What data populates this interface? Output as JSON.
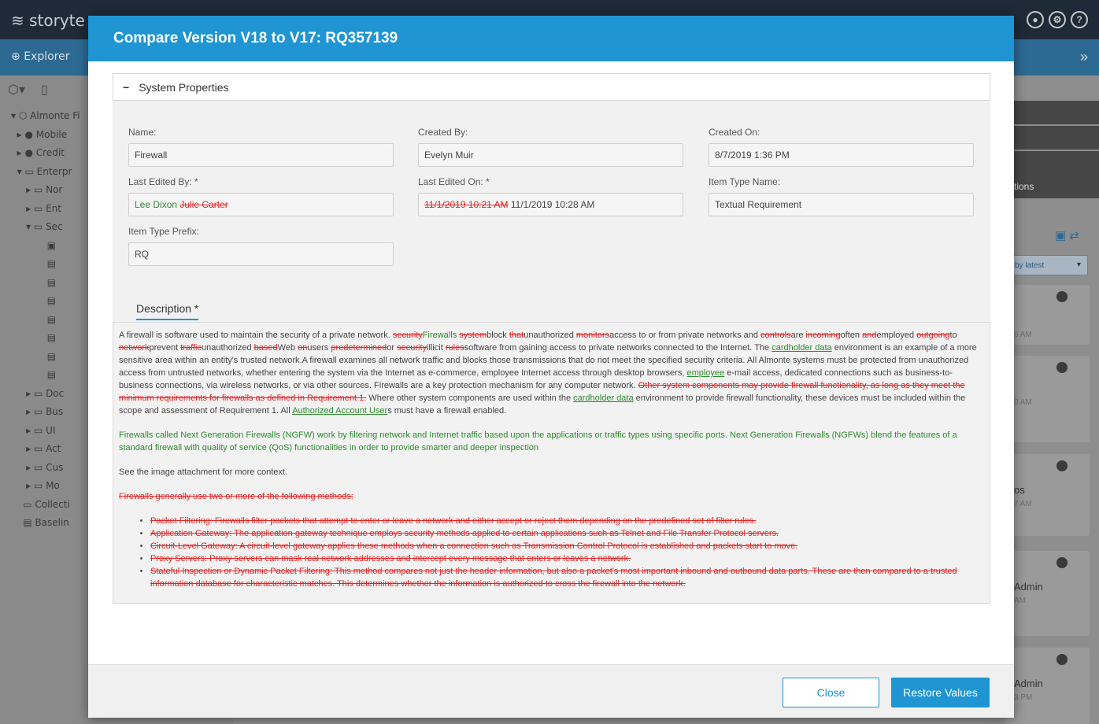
{
  "app": {
    "brand": "storyte",
    "explorer_label": "Explorer",
    "top_icons": [
      "user-icon",
      "settings-icon",
      "help-icon"
    ]
  },
  "tree": [
    {
      "label": "Almonte Fi"
    },
    {
      "label": "Mobile"
    },
    {
      "label": "Credit"
    },
    {
      "label": "Enterpr"
    },
    {
      "label": "Nor"
    },
    {
      "label": "Ent"
    },
    {
      "label": "Sec"
    },
    {
      "label": ""
    },
    {
      "label": ""
    },
    {
      "label": ""
    },
    {
      "label": ""
    },
    {
      "label": ""
    },
    {
      "label": ""
    },
    {
      "label": ""
    },
    {
      "label": ""
    },
    {
      "label": "Doc"
    },
    {
      "label": "Bus"
    },
    {
      "label": "UI"
    },
    {
      "label": "Act"
    },
    {
      "label": "Cus"
    },
    {
      "label": "Mo"
    },
    {
      "label": "Collecti"
    },
    {
      "label": "Baselin"
    }
  ],
  "right_panel": {
    "tab_text": "tions",
    "sort_label": "by latest",
    "cards": [
      {
        "title": "",
        "sub": "6 AM"
      },
      {
        "title": "",
        "sub": "0 AM"
      },
      {
        "title": "os",
        "sub": "7 AM"
      },
      {
        "title": "Admin",
        "sub": "AM"
      },
      {
        "title": "Admin",
        "sub": "3 PM"
      }
    ]
  },
  "modal": {
    "title": "Compare Version V18 to V17: RQ357139",
    "section_title": "System Properties",
    "fields": {
      "name": {
        "label": "Name:",
        "value": "Firewall"
      },
      "created_by": {
        "label": "Created By:",
        "value": "Evelyn Muir"
      },
      "created_on": {
        "label": "Created On:",
        "value": "8/7/2019 1:36 PM"
      },
      "last_edited_by": {
        "label": "Last Edited By: *",
        "new": "Lee Dixon",
        "old": "Julie Carter"
      },
      "last_edited_on": {
        "label": "Last Edited On: *",
        "old": "11/1/2019 10:21 AM",
        "new": "11/1/2019 10:28 AM"
      },
      "item_type_name": {
        "label": "Item Type Name:",
        "value": "Textual Requirement"
      },
      "item_type_prefix": {
        "label": "Item Type Prefix:",
        "value": "RQ"
      }
    },
    "description_tab": "Description *",
    "description": {
      "para3": "See the image attachment for more context.",
      "removed_heading": "Firewalls generally use two or more of the following methods:",
      "removed_list": [
        "Packet Filtering: Firewalls filter packets that attempt to enter or leave a network and either accept or reject them depending on the predefined set of filter rules.",
        "Application Gateway: The application gateway technique employs security methods applied to certain applications such as Telnet and File Transfer Protocol servers.",
        "Circuit-Level Gateway: A circuit-level gateway applies these methods when a connection such as Transmission Control Protocol is established and packets start to move.",
        "Proxy Servers: Proxy servers can mask real network addresses and intercept every message that enters or leaves a network.",
        "Stateful Inspection or Dynamic Packet Filtering: This method compares not just the header information, but also a packet's most important inbound and outbound data parts. These are then compared to a trusted information database for characteristic matches. This determines whether the information is authorized to cross the firewall into the network."
      ]
    },
    "buttons": {
      "close": "Close",
      "restore": "Restore Values"
    }
  }
}
